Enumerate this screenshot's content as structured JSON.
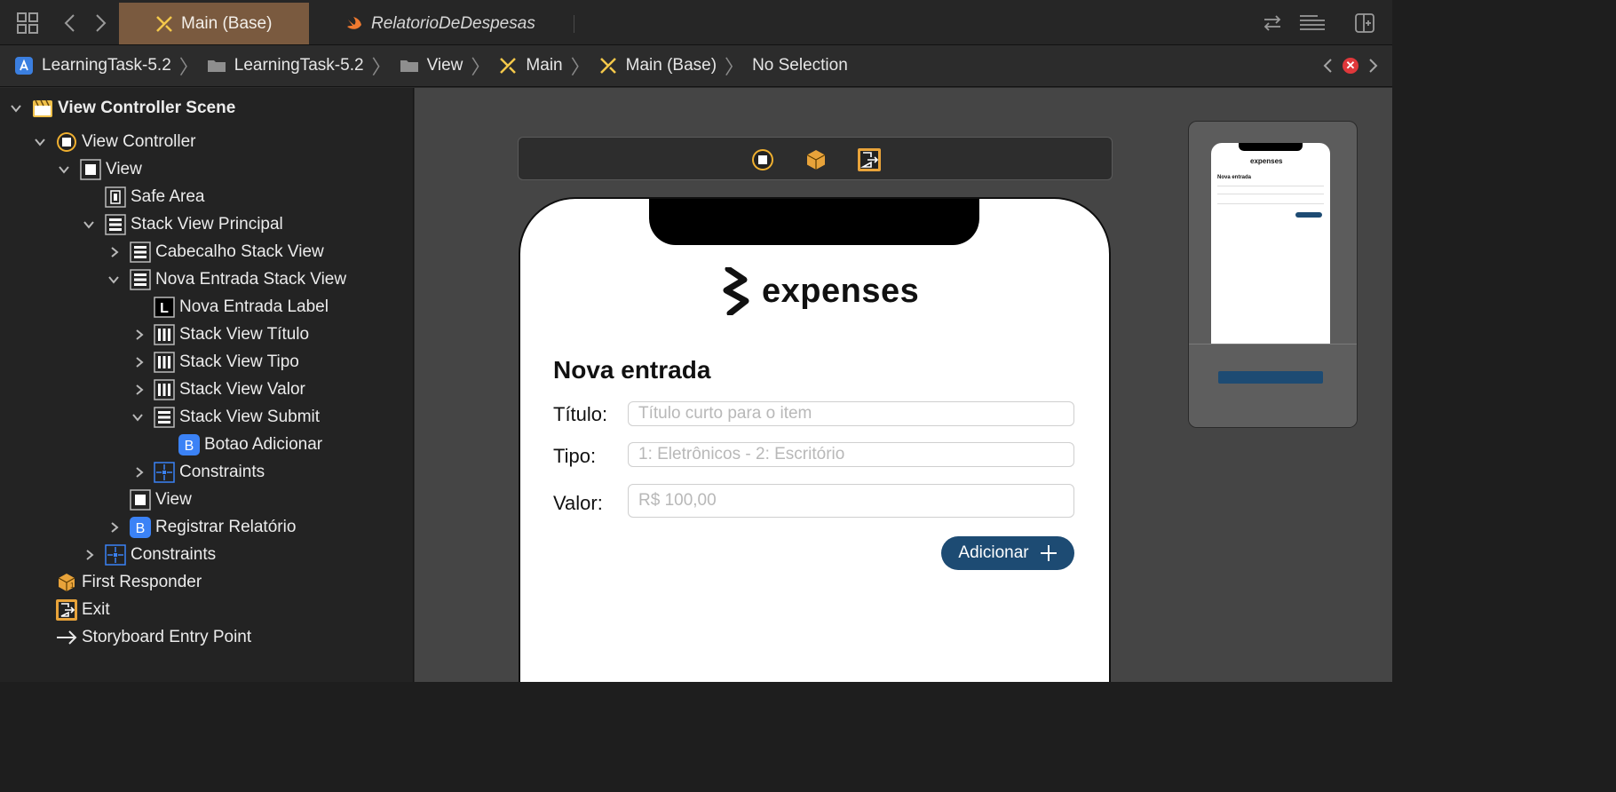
{
  "tabs": [
    {
      "label": "Main (Base)",
      "active": true,
      "icon": "storyboard-icon"
    },
    {
      "label": "RelatorioDeDespesas",
      "active": false,
      "icon": "swift-icon"
    }
  ],
  "breadcrumb": [
    {
      "label": "LearningTask-5.2",
      "icon": "app-project-icon"
    },
    {
      "label": "LearningTask-5.2",
      "icon": "folder-icon"
    },
    {
      "label": "View",
      "icon": "folder-icon"
    },
    {
      "label": "Main",
      "icon": "storyboard-icon"
    },
    {
      "label": "Main (Base)",
      "icon": "storyboard-icon"
    },
    {
      "label": "No Selection",
      "icon": ""
    }
  ],
  "outline": {
    "scene": "View Controller Scene",
    "items": [
      {
        "label": "View Controller"
      },
      {
        "label": "View"
      },
      {
        "label": "Safe Area"
      },
      {
        "label": "Stack View Principal"
      },
      {
        "label": "Cabecalho Stack View"
      },
      {
        "label": "Nova Entrada Stack View"
      },
      {
        "label": "Nova Entrada Label",
        "glyph": "L"
      },
      {
        "label": "Stack View Título"
      },
      {
        "label": "Stack View Tipo"
      },
      {
        "label": "Stack View Valor"
      },
      {
        "label": "Stack View Submit"
      },
      {
        "label": "Botao Adicionar",
        "glyph": "B"
      },
      {
        "label": "Constraints"
      },
      {
        "label": "View"
      },
      {
        "label": "Registrar Relatório",
        "glyph": "B"
      },
      {
        "label": "Constraints"
      },
      {
        "label": "First Responder"
      },
      {
        "label": "Exit"
      },
      {
        "label": "Storyboard Entry Point"
      }
    ]
  },
  "app": {
    "logo_text": "expenses",
    "form_title": "Nova entrada",
    "fields": [
      {
        "label": "Título:",
        "placeholder": "Título curto para o item"
      },
      {
        "label": "Tipo:",
        "placeholder": "1: Eletrônicos - 2: Escritório"
      },
      {
        "label": "Valor:",
        "placeholder": "R$ 100,00"
      }
    ],
    "add_button": "Adicionar",
    "minimap_logo": "expenses",
    "minimap_title": "Nova entrada"
  },
  "colors": {
    "active_tab": "#7a5a3f",
    "button_blue": "#1d4b73",
    "error_red": "#e0383b",
    "xcode_blue": "#3b82f6",
    "xcode_orange": "#e8a33a"
  }
}
